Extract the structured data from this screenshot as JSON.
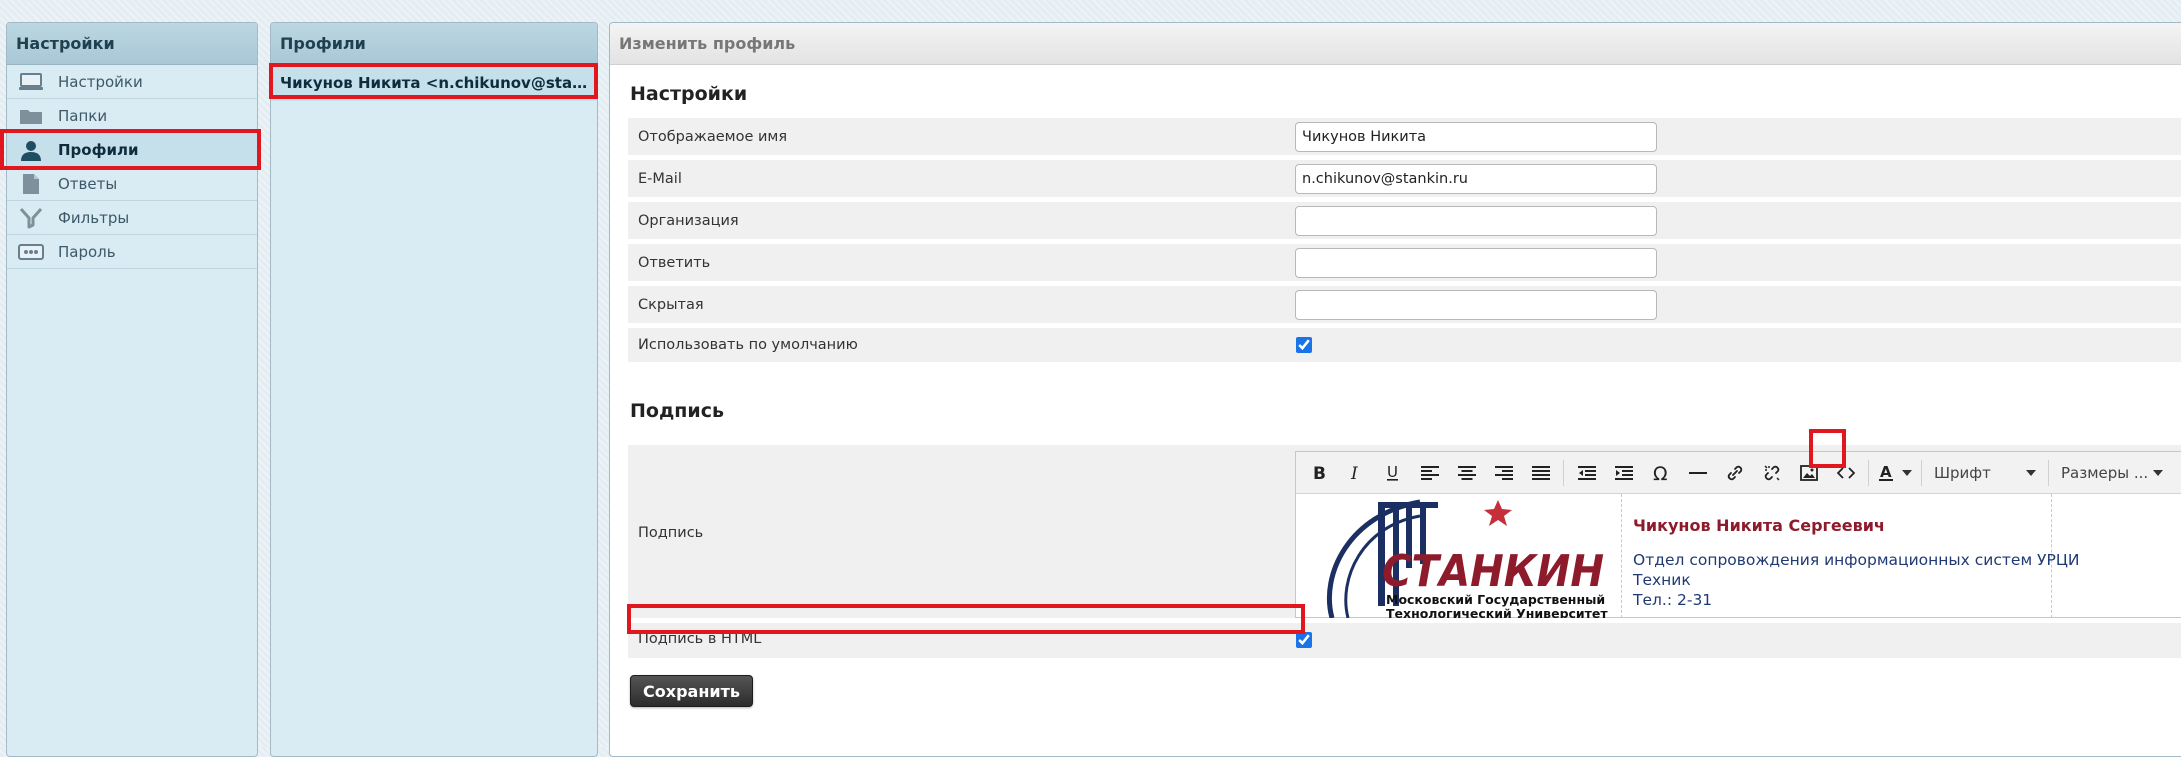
{
  "left_panel": {
    "title": "Настройки",
    "items": [
      {
        "label": "Настройки",
        "icon": "monitor-icon"
      },
      {
        "label": "Папки",
        "icon": "folder-icon"
      },
      {
        "label": "Профили",
        "icon": "user-icon",
        "active": true
      },
      {
        "label": "Ответы",
        "icon": "document-icon"
      },
      {
        "label": "Фильтры",
        "icon": "filter-icon"
      },
      {
        "label": "Пароль",
        "icon": "password-icon"
      }
    ]
  },
  "middle_panel": {
    "title": "Профили",
    "profile": "Чикунов Никита <n.chikunov@stankin.ru>"
  },
  "right_panel": {
    "title": "Изменить профиль",
    "settings_section": "Настройки",
    "fields": {
      "display_name": {
        "label": "Отображаемое имя",
        "value": "Чикунов Никита"
      },
      "email": {
        "label": "E-Mail",
        "value": "n.chikunov@stankin.ru"
      },
      "organization": {
        "label": "Организация",
        "value": ""
      },
      "reply_to": {
        "label": "Ответить",
        "value": ""
      },
      "bcc": {
        "label": "Скрытая",
        "value": ""
      },
      "default": {
        "label": "Использовать по умолчанию",
        "checked": true
      }
    },
    "signature_section": "Подпись",
    "signature": {
      "label": "Подпись",
      "toolbar": {
        "font_label": "Шрифт",
        "size_label": "Размеры ..."
      },
      "content": {
        "logo_text": "СТАНКИН",
        "logo_sub1": "Московский Государственный",
        "logo_sub2": "Технологический Университет",
        "name": "Чикунов Никита Сергеевич",
        "department": "Отдел сопровождения информационных систем УРЦИ",
        "position": "Техник",
        "phone": "Тел.: 2-31"
      }
    },
    "html_signature": {
      "label": "Подпись в HTML",
      "checked": true
    },
    "save_label": "Сохранить"
  },
  "colors": {
    "accent_red": "#e0171f",
    "brand_red": "#8d1b2c",
    "brand_navy": "#1f3a73"
  }
}
